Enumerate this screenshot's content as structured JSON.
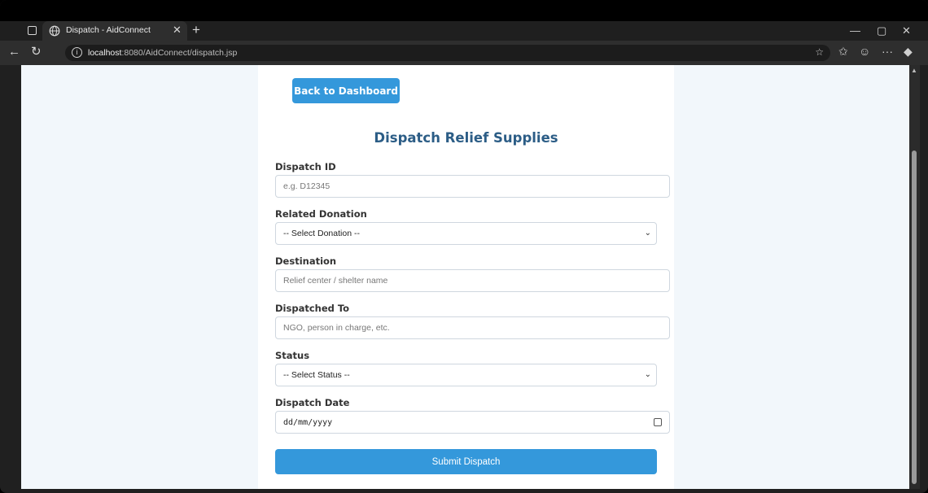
{
  "browser": {
    "tab_title": "Dispatch - AidConnect",
    "url_host": "localhost",
    "url_path": ":8080/AidConnect/dispatch.jsp"
  },
  "page": {
    "back_label": "Back to Dashboard",
    "title": "Dispatch Relief Supplies",
    "dispatch_id": {
      "label": "Dispatch ID",
      "placeholder": "e.g. D12345"
    },
    "related_donation": {
      "label": "Related Donation",
      "value": "-- Select Donation --"
    },
    "destination": {
      "label": "Destination",
      "placeholder": "Relief center / shelter name"
    },
    "dispatched_to": {
      "label": "Dispatched To",
      "placeholder": "NGO, person in charge, etc."
    },
    "status": {
      "label": "Status",
      "value": "-- Select Status --"
    },
    "dispatch_date": {
      "label": "Dispatch Date",
      "value": "dd/mm/yyyy"
    },
    "submit_label": "Submit Dispatch"
  },
  "colors": {
    "accent": "#3498db",
    "title": "#2c5d86",
    "background": "#f2f7fb"
  }
}
